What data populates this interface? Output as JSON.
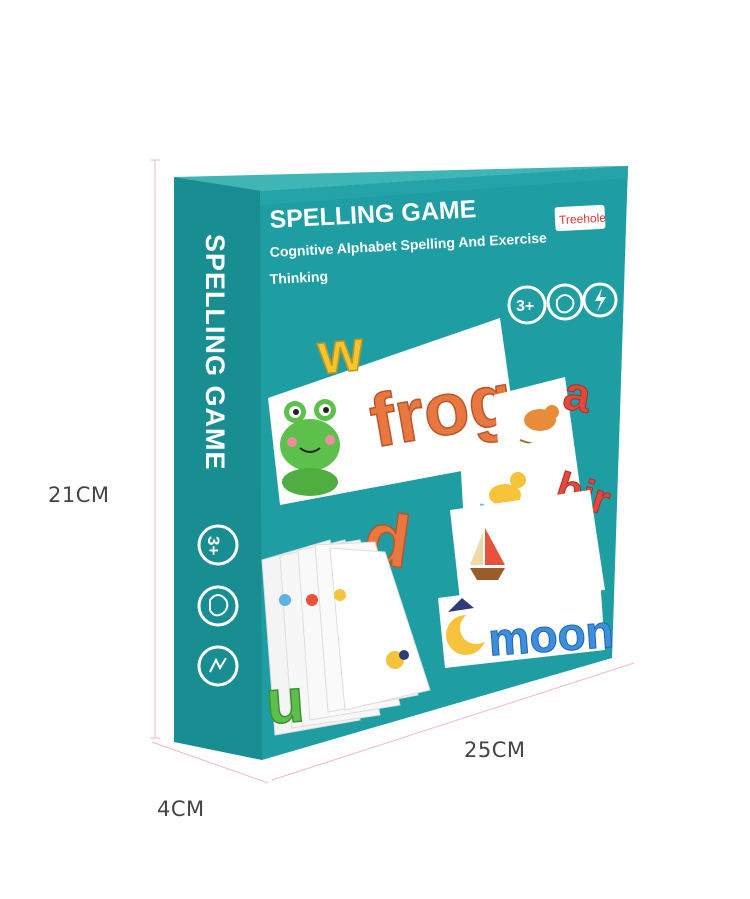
{
  "dimensions": {
    "height": "21CM",
    "width": "25CM",
    "depth": "4CM"
  },
  "box": {
    "title": "SPELLING GAME",
    "subtitle_line1": "Cognitive Alphabet Spelling And Exercise",
    "subtitle_line2": "Thinking",
    "brand": "Treehole",
    "age_badge": "3+",
    "side_title": "SPELLING GAME",
    "side_age_badge": "3+"
  },
  "cards": {
    "card1_word": "frog",
    "card1_loose_letter": "w",
    "card2_word": "moon",
    "card3_partial": "bir",
    "loose_letter_a": "a",
    "loose_letter_d": "d",
    "loose_letter_u": "u"
  },
  "colors": {
    "box_teal": "#1e9ea3",
    "box_side": "#188e93",
    "box_top": "#3fb5b5"
  }
}
